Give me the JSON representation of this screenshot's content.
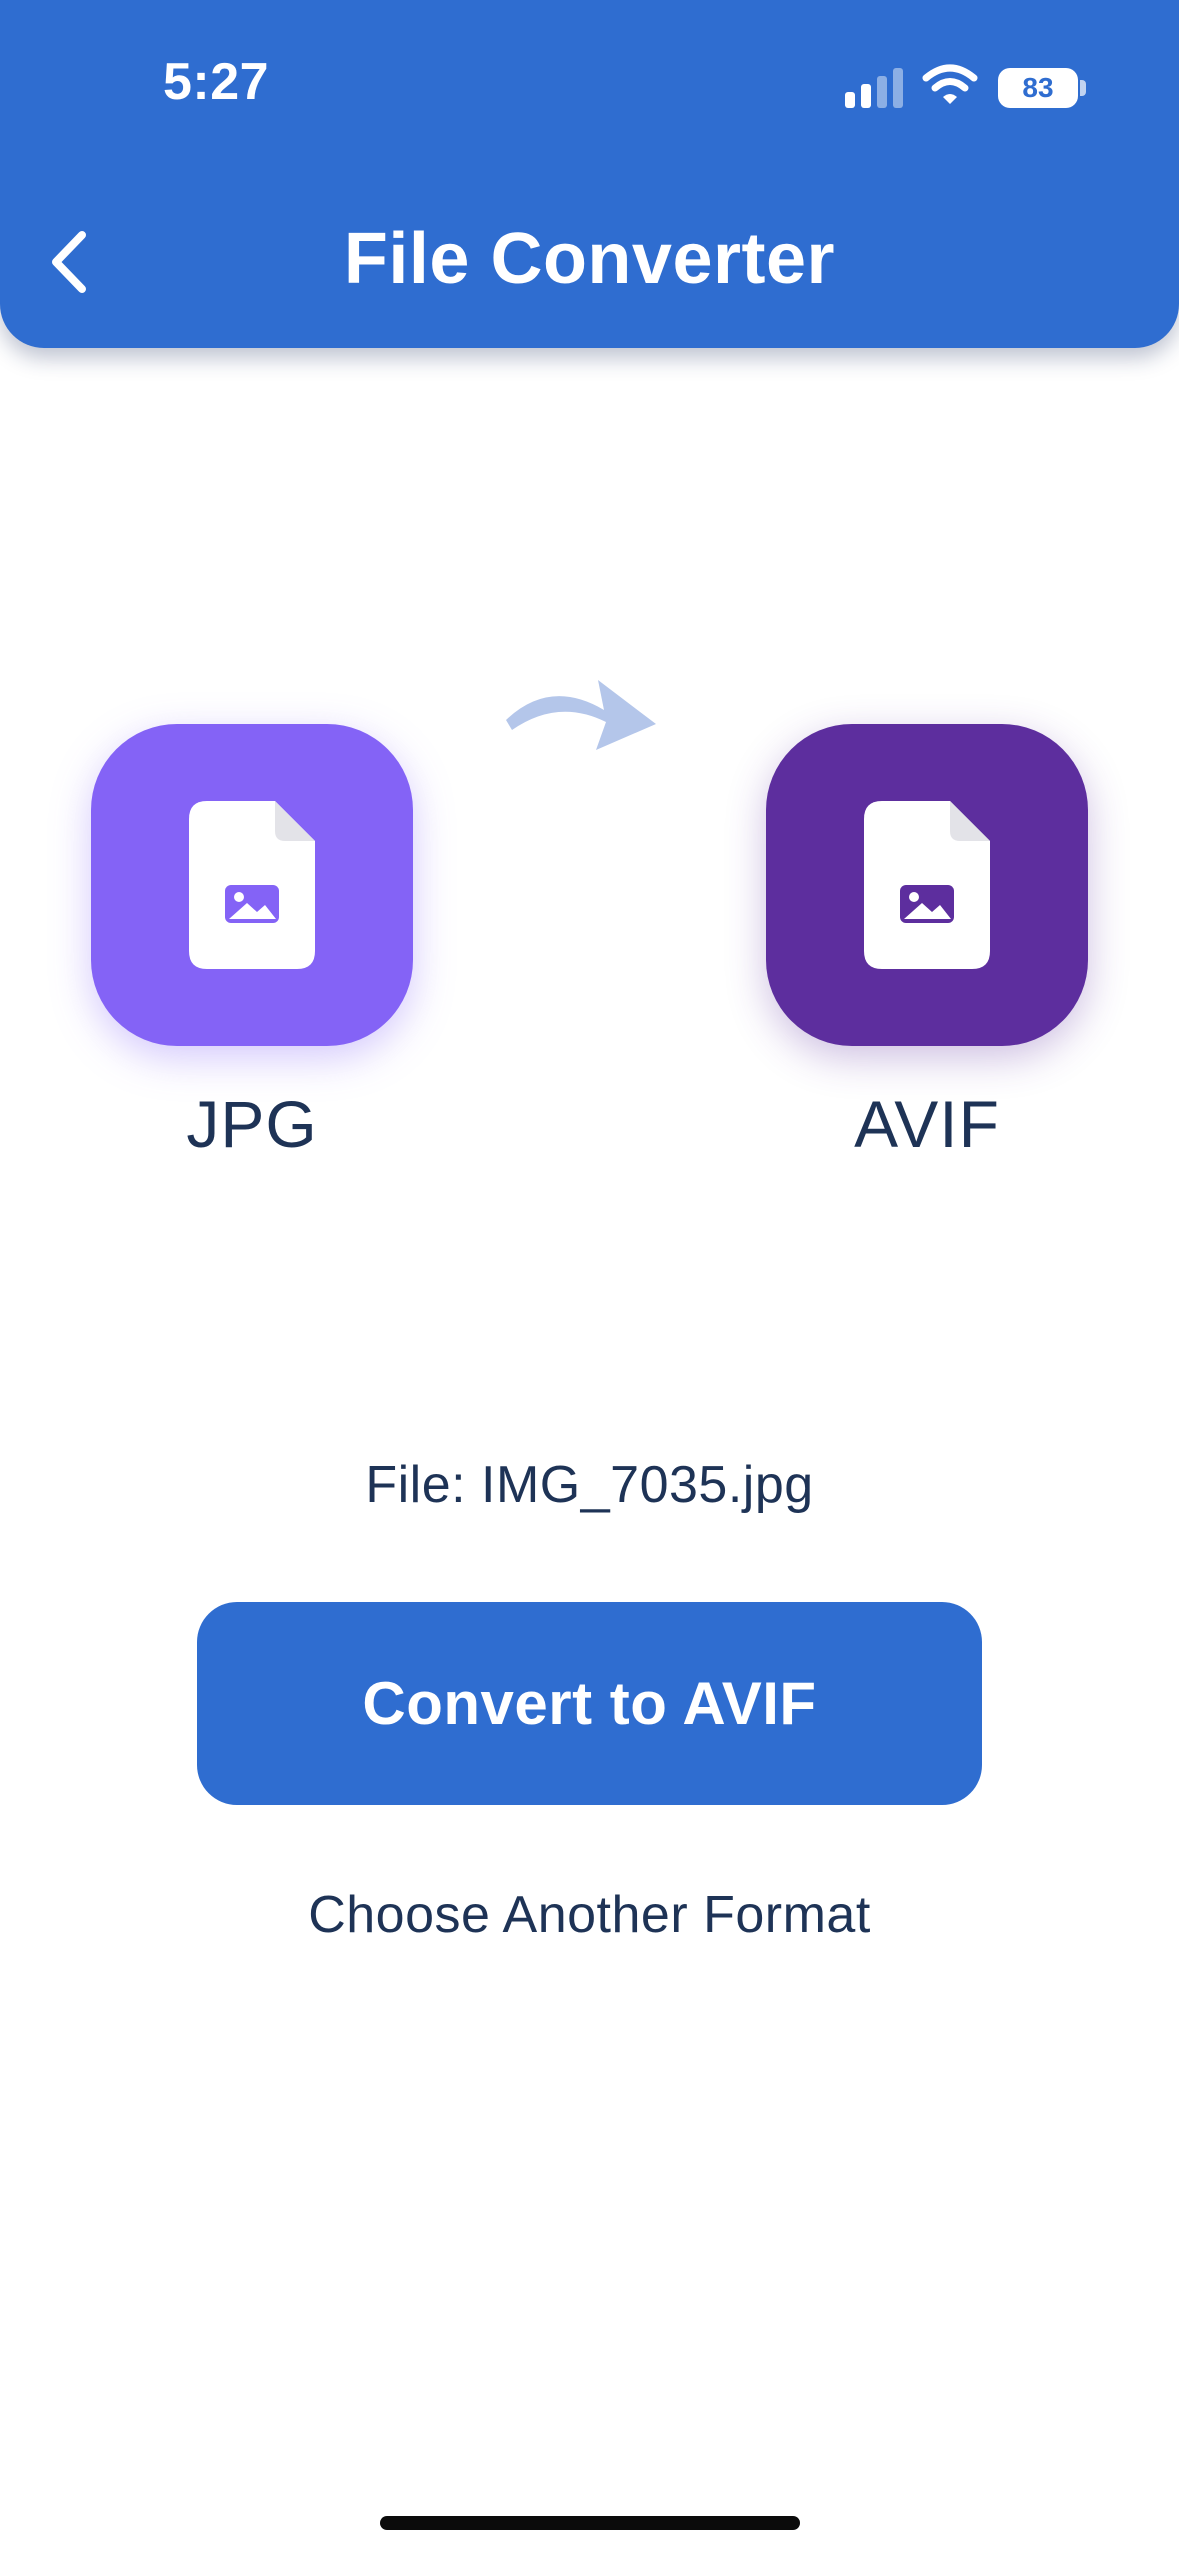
{
  "status_bar": {
    "time": "5:27",
    "battery": "83",
    "icons": [
      "signal-icon",
      "wifi-icon",
      "battery-icon"
    ]
  },
  "header": {
    "title": "File Converter",
    "back_icon": "chevron-left-icon"
  },
  "conversion": {
    "from_format": "JPG",
    "to_format": "AVIF",
    "from_color": "#8463f6",
    "to_color": "#5d2e9e",
    "arrow_icon": "curved-arrow-icon",
    "file_icon": "image-file-icon"
  },
  "file_label": "File: IMG_7035.jpg",
  "actions": {
    "convert_label": "Convert to AVIF",
    "choose_label": "Choose Another Format"
  },
  "colors": {
    "primary": "#2f6dd0",
    "text": "#1e3356",
    "arrow": "#b4c6ea"
  }
}
